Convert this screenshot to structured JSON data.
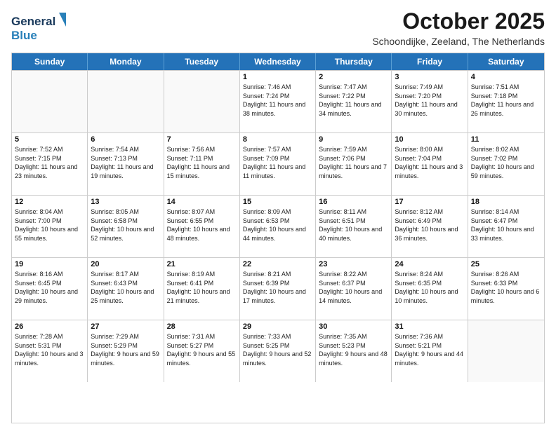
{
  "header": {
    "logo_general": "General",
    "logo_blue": "Blue",
    "month_title": "October 2025",
    "location": "Schoondijke, Zeeland, The Netherlands"
  },
  "days_of_week": [
    "Sunday",
    "Monday",
    "Tuesday",
    "Wednesday",
    "Thursday",
    "Friday",
    "Saturday"
  ],
  "weeks": [
    [
      {
        "day": "",
        "info": ""
      },
      {
        "day": "",
        "info": ""
      },
      {
        "day": "",
        "info": ""
      },
      {
        "day": "1",
        "info": "Sunrise: 7:46 AM\nSunset: 7:24 PM\nDaylight: 11 hours\nand 38 minutes."
      },
      {
        "day": "2",
        "info": "Sunrise: 7:47 AM\nSunset: 7:22 PM\nDaylight: 11 hours\nand 34 minutes."
      },
      {
        "day": "3",
        "info": "Sunrise: 7:49 AM\nSunset: 7:20 PM\nDaylight: 11 hours\nand 30 minutes."
      },
      {
        "day": "4",
        "info": "Sunrise: 7:51 AM\nSunset: 7:18 PM\nDaylight: 11 hours\nand 26 minutes."
      }
    ],
    [
      {
        "day": "5",
        "info": "Sunrise: 7:52 AM\nSunset: 7:15 PM\nDaylight: 11 hours\nand 23 minutes."
      },
      {
        "day": "6",
        "info": "Sunrise: 7:54 AM\nSunset: 7:13 PM\nDaylight: 11 hours\nand 19 minutes."
      },
      {
        "day": "7",
        "info": "Sunrise: 7:56 AM\nSunset: 7:11 PM\nDaylight: 11 hours\nand 15 minutes."
      },
      {
        "day": "8",
        "info": "Sunrise: 7:57 AM\nSunset: 7:09 PM\nDaylight: 11 hours\nand 11 minutes."
      },
      {
        "day": "9",
        "info": "Sunrise: 7:59 AM\nSunset: 7:06 PM\nDaylight: 11 hours\nand 7 minutes."
      },
      {
        "day": "10",
        "info": "Sunrise: 8:00 AM\nSunset: 7:04 PM\nDaylight: 11 hours\nand 3 minutes."
      },
      {
        "day": "11",
        "info": "Sunrise: 8:02 AM\nSunset: 7:02 PM\nDaylight: 10 hours\nand 59 minutes."
      }
    ],
    [
      {
        "day": "12",
        "info": "Sunrise: 8:04 AM\nSunset: 7:00 PM\nDaylight: 10 hours\nand 55 minutes."
      },
      {
        "day": "13",
        "info": "Sunrise: 8:05 AM\nSunset: 6:58 PM\nDaylight: 10 hours\nand 52 minutes."
      },
      {
        "day": "14",
        "info": "Sunrise: 8:07 AM\nSunset: 6:55 PM\nDaylight: 10 hours\nand 48 minutes."
      },
      {
        "day": "15",
        "info": "Sunrise: 8:09 AM\nSunset: 6:53 PM\nDaylight: 10 hours\nand 44 minutes."
      },
      {
        "day": "16",
        "info": "Sunrise: 8:11 AM\nSunset: 6:51 PM\nDaylight: 10 hours\nand 40 minutes."
      },
      {
        "day": "17",
        "info": "Sunrise: 8:12 AM\nSunset: 6:49 PM\nDaylight: 10 hours\nand 36 minutes."
      },
      {
        "day": "18",
        "info": "Sunrise: 8:14 AM\nSunset: 6:47 PM\nDaylight: 10 hours\nand 33 minutes."
      }
    ],
    [
      {
        "day": "19",
        "info": "Sunrise: 8:16 AM\nSunset: 6:45 PM\nDaylight: 10 hours\nand 29 minutes."
      },
      {
        "day": "20",
        "info": "Sunrise: 8:17 AM\nSunset: 6:43 PM\nDaylight: 10 hours\nand 25 minutes."
      },
      {
        "day": "21",
        "info": "Sunrise: 8:19 AM\nSunset: 6:41 PM\nDaylight: 10 hours\nand 21 minutes."
      },
      {
        "day": "22",
        "info": "Sunrise: 8:21 AM\nSunset: 6:39 PM\nDaylight: 10 hours\nand 17 minutes."
      },
      {
        "day": "23",
        "info": "Sunrise: 8:22 AM\nSunset: 6:37 PM\nDaylight: 10 hours\nand 14 minutes."
      },
      {
        "day": "24",
        "info": "Sunrise: 8:24 AM\nSunset: 6:35 PM\nDaylight: 10 hours\nand 10 minutes."
      },
      {
        "day": "25",
        "info": "Sunrise: 8:26 AM\nSunset: 6:33 PM\nDaylight: 10 hours\nand 6 minutes."
      }
    ],
    [
      {
        "day": "26",
        "info": "Sunrise: 7:28 AM\nSunset: 5:31 PM\nDaylight: 10 hours\nand 3 minutes."
      },
      {
        "day": "27",
        "info": "Sunrise: 7:29 AM\nSunset: 5:29 PM\nDaylight: 9 hours\nand 59 minutes."
      },
      {
        "day": "28",
        "info": "Sunrise: 7:31 AM\nSunset: 5:27 PM\nDaylight: 9 hours\nand 55 minutes."
      },
      {
        "day": "29",
        "info": "Sunrise: 7:33 AM\nSunset: 5:25 PM\nDaylight: 9 hours\nand 52 minutes."
      },
      {
        "day": "30",
        "info": "Sunrise: 7:35 AM\nSunset: 5:23 PM\nDaylight: 9 hours\nand 48 minutes."
      },
      {
        "day": "31",
        "info": "Sunrise: 7:36 AM\nSunset: 5:21 PM\nDaylight: 9 hours\nand 44 minutes."
      },
      {
        "day": "",
        "info": ""
      }
    ]
  ]
}
